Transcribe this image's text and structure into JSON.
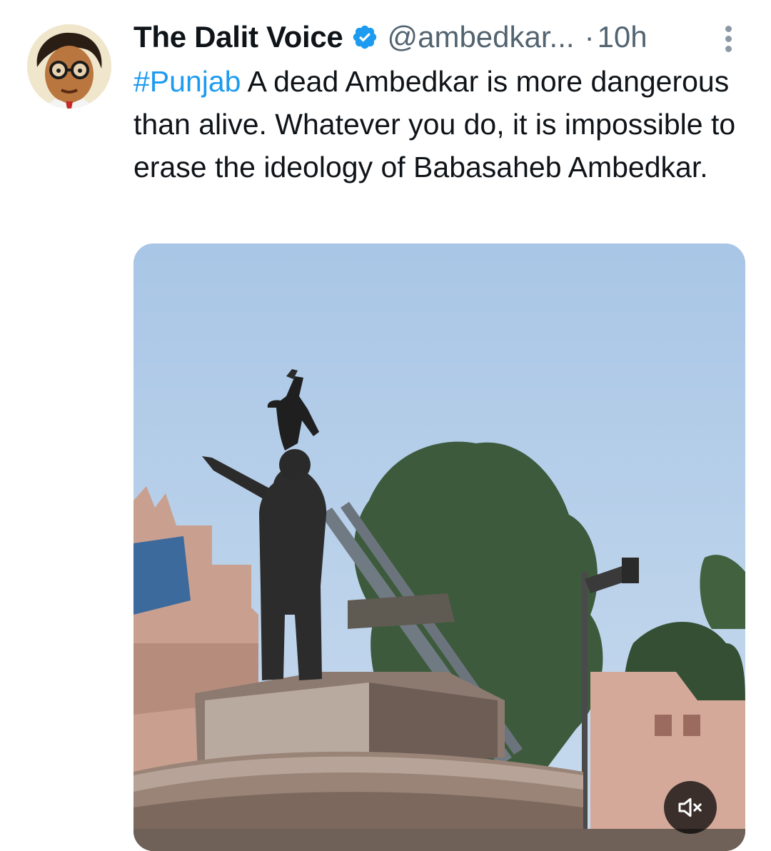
{
  "author": {
    "display_name": "The Dalit Voice",
    "handle": "@ambedkar...",
    "separator": "·",
    "time": "10h",
    "verified_icon": "verified-badge-icon",
    "avatar": "profile-avatar"
  },
  "tweet": {
    "hashtag": "#Punjab",
    "text": " A dead Ambedkar is more dangerous than alive. Whatever you do, it is impossible to erase the ideology of Babasaheb Ambedkar."
  },
  "media": {
    "type": "video",
    "mute_icon": "speaker-muted-icon"
  },
  "colors": {
    "accent": "#1d9bf0",
    "secondary_text": "#536471",
    "primary_text": "#0f1419"
  }
}
